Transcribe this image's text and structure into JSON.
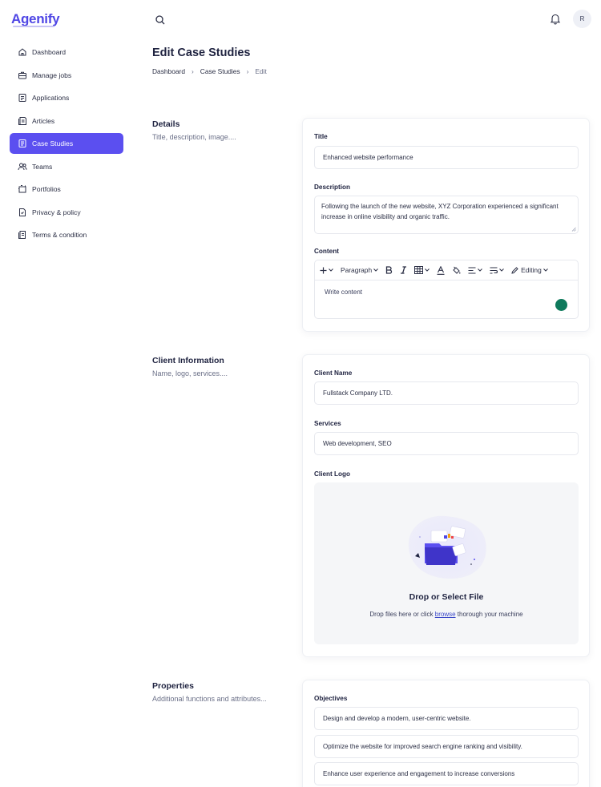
{
  "app": {
    "logo": "Agenify"
  },
  "sidebar": {
    "items": [
      {
        "label": "Dashboard",
        "icon": "home-icon"
      },
      {
        "label": "Manage jobs",
        "icon": "briefcase-icon"
      },
      {
        "label": "Applications",
        "icon": "clipboard-icon"
      },
      {
        "label": "Articles",
        "icon": "article-icon"
      },
      {
        "label": "Case Studies",
        "icon": "document-icon",
        "active": true
      },
      {
        "label": "Teams",
        "icon": "users-icon"
      },
      {
        "label": "Portfolios",
        "icon": "portfolio-icon"
      },
      {
        "label": "Privacy & policy",
        "icon": "shield-document-icon"
      },
      {
        "label": "Terms & condition",
        "icon": "terms-icon"
      }
    ]
  },
  "header": {
    "avatar_initial": "R",
    "icons": [
      "search-icon",
      "bell-icon"
    ]
  },
  "page": {
    "title": "Edit Case Studies",
    "breadcrumb": [
      "Dashboard",
      "Case Studies",
      "Edit"
    ]
  },
  "details": {
    "title": "Details",
    "subtitle": "Title, description, image....",
    "title_label": "Title",
    "title_value": "Enhanced website performance",
    "description_label": "Description",
    "description_value": "Following the launch of the new website, XYZ Corporation experienced a significant increase in online visibility and organic traffic.",
    "content_label": "Content",
    "toolbar": {
      "paragraph": "Paragraph",
      "editing": "Editing"
    },
    "content_placeholder": "Write content"
  },
  "client": {
    "title": "Client Information",
    "subtitle": "Name, logo, services....",
    "name_label": "Client Name",
    "name_value": "Fullstack Company LTD.",
    "services_label": "Services",
    "services_value": "Web development, SEO",
    "logo_label": "Client Logo",
    "drop_title": "Drop or Select File",
    "drop_pre": "Drop files here or click",
    "drop_link": "browse",
    "drop_post": "thorough your machine"
  },
  "properties": {
    "title": "Properties",
    "subtitle": "Additional functions and attributes...",
    "objectives_label": "Objectives",
    "objectives": [
      "Design and develop a modern, user-centric website.",
      "Optimize the website for improved search engine ranking and visibility.",
      "Enhance user experience and engagement to increase conversions"
    ]
  },
  "colors": {
    "accent": "#5b4ff0",
    "brand": "#4f46e5",
    "chat": "#0f7a5c"
  }
}
